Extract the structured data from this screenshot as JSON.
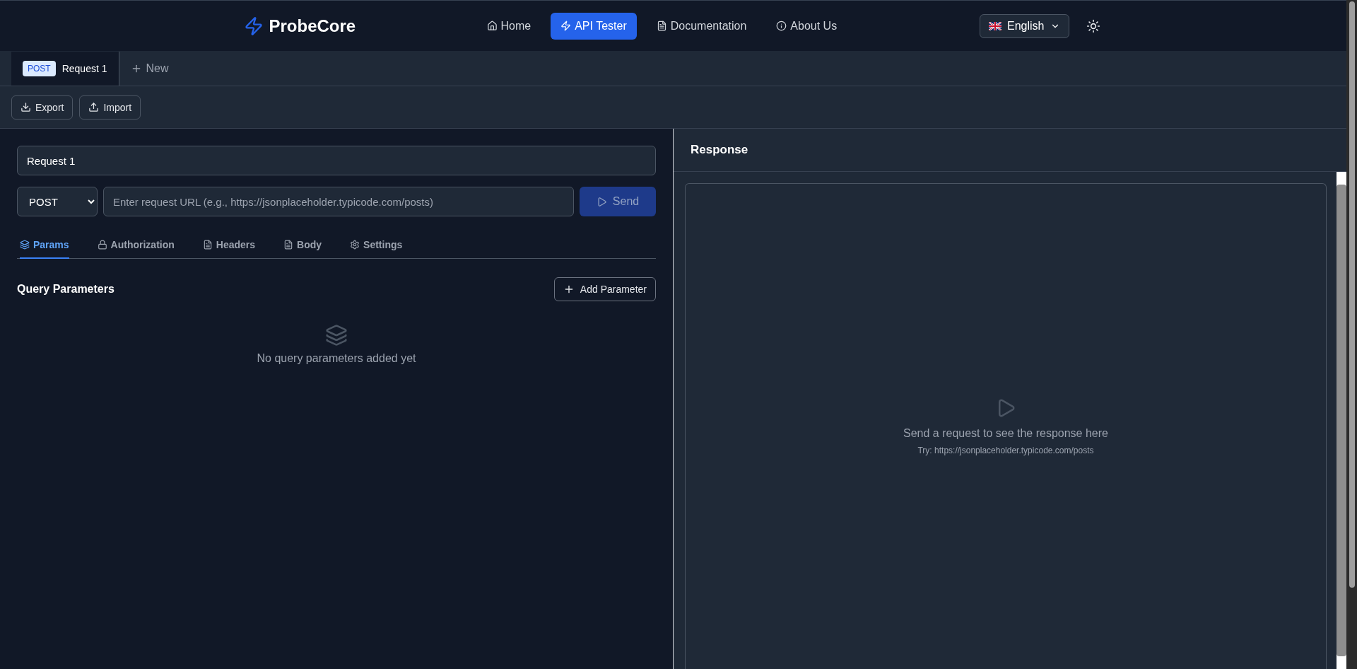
{
  "brand": {
    "name": "ProbeCore"
  },
  "nav": [
    {
      "label": "Home",
      "selected": false
    },
    {
      "label": "API Tester",
      "selected": true
    },
    {
      "label": "Documentation",
      "selected": false
    },
    {
      "label": "About Us",
      "selected": false
    }
  ],
  "language": {
    "label": "English"
  },
  "request_tabs": [
    {
      "method": "POST",
      "title": "Request 1",
      "selected": true
    }
  ],
  "new_tab": {
    "label": "New"
  },
  "toolbar": [
    {
      "label": "Export"
    },
    {
      "label": "Import"
    }
  ],
  "request": {
    "name": "Request 1",
    "method": "POST",
    "url_placeholder": "Enter request URL (e.g., https://jsonplaceholder.typicode.com/posts)",
    "send": {
      "label": "Send",
      "disabled": true
    }
  },
  "sub_tabs": [
    {
      "label": "Params",
      "selected": true
    },
    {
      "label": "Authorization",
      "selected": false
    },
    {
      "label": "Headers",
      "selected": false
    },
    {
      "label": "Body",
      "selected": false
    },
    {
      "label": "Settings",
      "selected": false
    }
  ],
  "params": {
    "title": "Query Parameters",
    "add_button": "Add Parameter",
    "empty_text": "No query parameters added yet"
  },
  "response": {
    "title": "Response",
    "empty_text": "Send a request to see the response here",
    "hint": "Try: https://jsonplaceholder.typicode.com/posts"
  }
}
